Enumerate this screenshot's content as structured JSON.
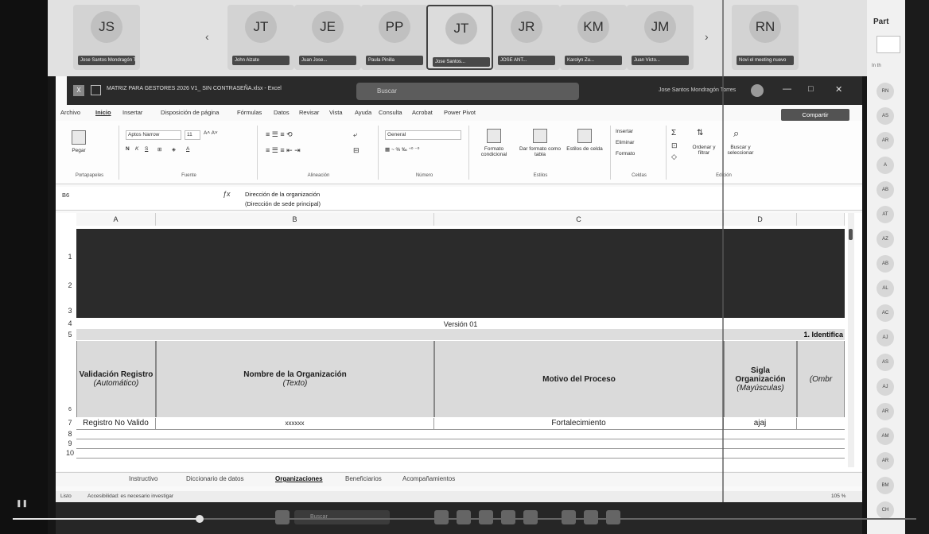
{
  "participants": [
    {
      "initials": "JS",
      "name": "Jose Santos Mondragón T.",
      "active": false
    },
    {
      "initials": "JT",
      "name": "John Alzate",
      "active": false
    },
    {
      "initials": "JE",
      "name": "Juan Jose...",
      "active": false
    },
    {
      "initials": "PP",
      "name": "Paula Pinilla",
      "active": false
    },
    {
      "initials": "JT",
      "name": "Jose Santos...",
      "active": true
    },
    {
      "initials": "JR",
      "name": "JOSE ANT...",
      "active": false
    },
    {
      "initials": "KM",
      "name": "Karolyn Zu...",
      "active": false
    },
    {
      "initials": "JM",
      "name": "Juan Victo...",
      "active": false
    },
    {
      "initials": "RN",
      "name": "Novi el meeting nuevo",
      "active": false
    }
  ],
  "side_panel": {
    "title": "Part",
    "subtitle": "In th",
    "avatars": [
      "RN",
      "AS",
      "AR",
      "A",
      "AB",
      "AT",
      "AZ",
      "AB",
      "AL",
      "AC",
      "AJ",
      "AS",
      "AJ",
      "AR",
      "AM",
      "AR",
      "BM",
      "CH"
    ]
  },
  "excel": {
    "doc_title": "MATRIZ PARA GESTORES 2026 V1_ SIN CONTRASEÑA.xlsx - Excel",
    "search_placeholder": "Buscar",
    "user_name": "Jose Santos Mondragón Torres",
    "menu": [
      "Archivo",
      "Inicio",
      "Insertar",
      "Disposición de página",
      "Fórmulas",
      "Datos",
      "Revisar",
      "Vista",
      "Ayuda",
      "Consulta",
      "Acrobat",
      "Power Pivot"
    ],
    "active_menu": "Inicio",
    "share_label": "Compartir",
    "ribbon": {
      "clipboard_label": "Portapapeles",
      "paste_label": "Pegar",
      "font_label": "Fuente",
      "font_name": "Aptos Narrow",
      "font_size": "11",
      "alignment_label": "Alineación",
      "number_label": "Número",
      "number_format": "General",
      "styles_label": "Estilos",
      "cond_format": "Formato condicional",
      "as_table": "Dar formato como tabla",
      "cell_styles": "Estilos de celda",
      "cells_label": "Celdas",
      "insert": "Insertar",
      "delete": "Eliminar",
      "format": "Formato",
      "editing_label": "Edición",
      "sort_filter": "Ordenar y filtrar",
      "find_select": "Buscar y seleccionar"
    },
    "namebox": "B6",
    "formula_line1": "Dirección de la organización",
    "formula_line2": "(Dirección de sede principal)",
    "columns": [
      "A",
      "B",
      "C",
      "D"
    ],
    "rows": [
      "1",
      "2",
      "3",
      "4",
      "5",
      "6",
      "7",
      "8",
      "9",
      "10"
    ],
    "version_text": "Versión 01",
    "section_text": "1. Identifica",
    "headers": [
      {
        "title": "Validación Registro",
        "sub": "(Automático)"
      },
      {
        "title": "Nombre de la Organización",
        "sub": "(Texto)"
      },
      {
        "title": "Motivo del Proceso",
        "sub": ""
      },
      {
        "title": "Sigla Organización",
        "sub": "(Mayúsculas)"
      },
      {
        "title": "",
        "sub": "(Ombr"
      }
    ],
    "row7": [
      "Registro No Valido",
      "xxxxxx",
      "Fortalecimiento",
      "ajaj"
    ],
    "sheet_tabs": [
      "Instructivo",
      "Diccionario de datos",
      "Organizaciones",
      "Beneficiarios",
      "Acompañamientos"
    ],
    "active_tab": "Organizaciones",
    "status_left": "Listo",
    "status_accessibility": "Accesibilidad: es necesario investigar",
    "zoom": "105 %"
  },
  "taskbar": {
    "search_placeholder": "Buscar"
  }
}
